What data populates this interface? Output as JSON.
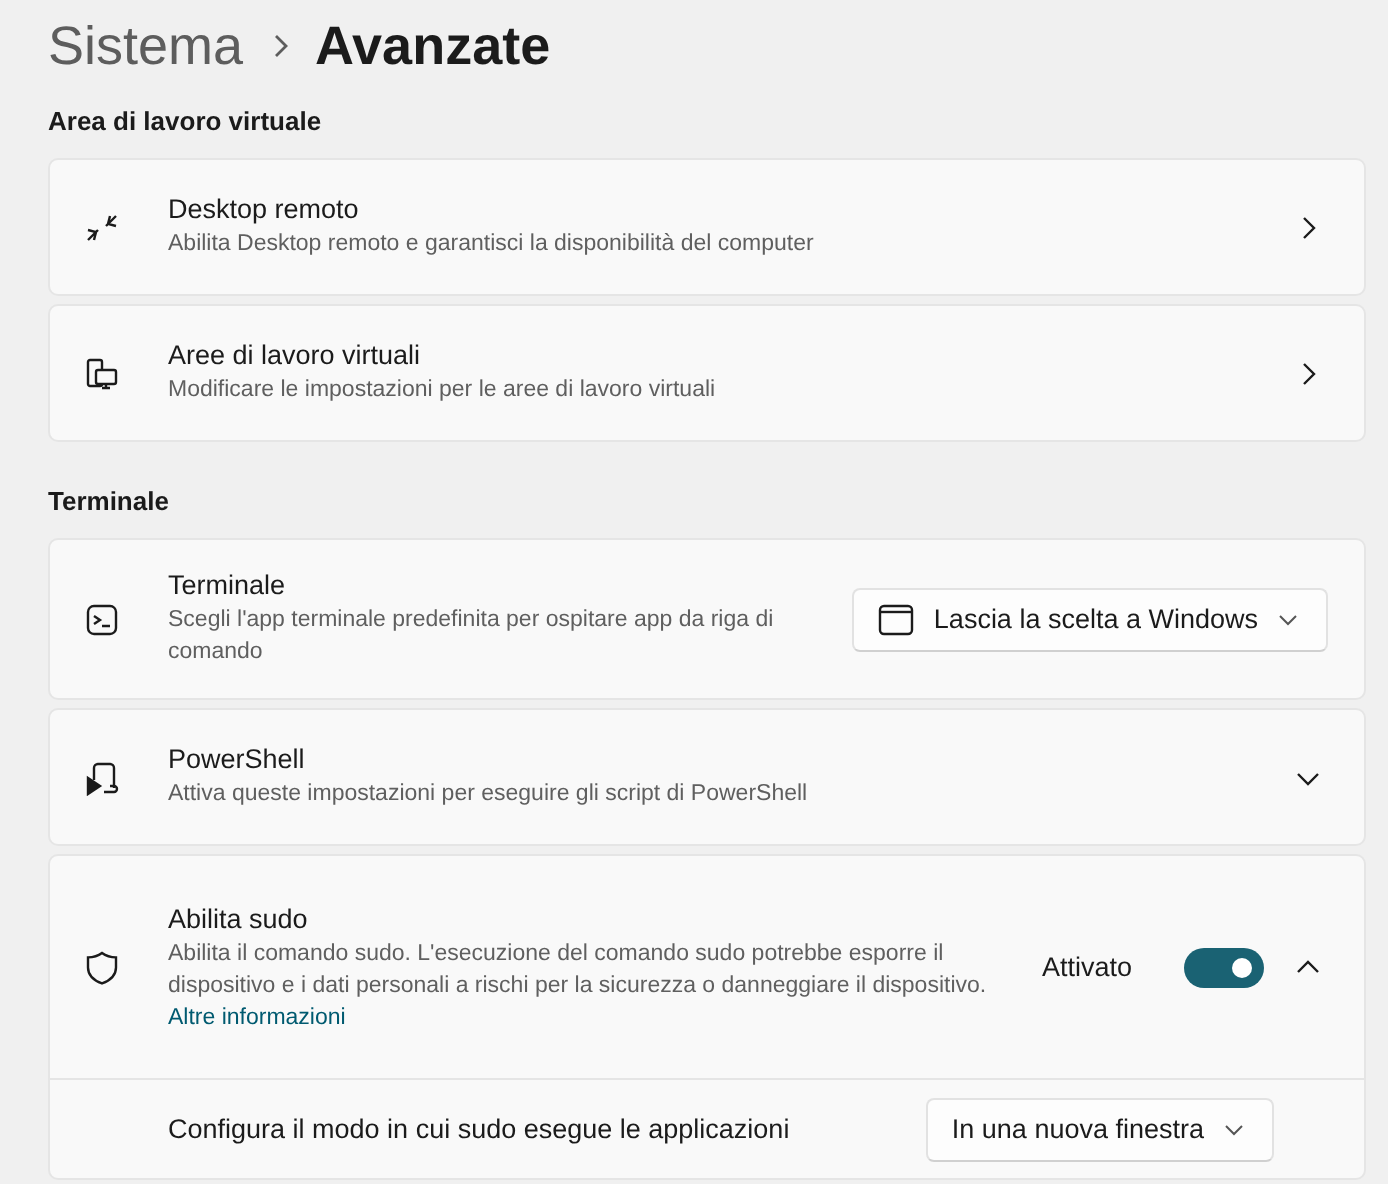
{
  "breadcrumb": {
    "parent": "Sistema",
    "current": "Avanzate"
  },
  "sections": [
    {
      "heading": "Area di lavoro virtuale",
      "items": [
        {
          "kind": "link",
          "title": "Desktop remoto",
          "description": "Abilita Desktop remoto e garantisci la disponibilità del computer"
        },
        {
          "kind": "link",
          "title": "Aree di lavoro virtuali",
          "description": "Modificare le impostazioni per le aree di lavoro virtuali"
        }
      ]
    },
    {
      "heading": "Terminale",
      "items": [
        {
          "kind": "dropdown",
          "title": "Terminale",
          "description": "Scegli l'app terminale predefinita per ospitare app da riga di comando",
          "value": "Lascia la scelta a Windows"
        },
        {
          "kind": "expander",
          "title": "PowerShell",
          "description": "Attiva queste impostazioni per eseguire gli script di PowerShell",
          "expanded": false
        },
        {
          "kind": "toggle",
          "title": "Abilita sudo",
          "description": "Abilita il comando sudo. L'esecuzione del comando sudo potrebbe esporre il dispositivo e i dati personali a rischi per la sicurezza o danneggiare il dispositivo.",
          "link": "Altre informazioni",
          "state_label": "Attivato",
          "on": true,
          "expanded": true,
          "sub_row": {
            "label": "Configura il modo in cui sudo esegue le applicazioni",
            "value": "In una nuova finestra"
          }
        }
      ]
    }
  ]
}
